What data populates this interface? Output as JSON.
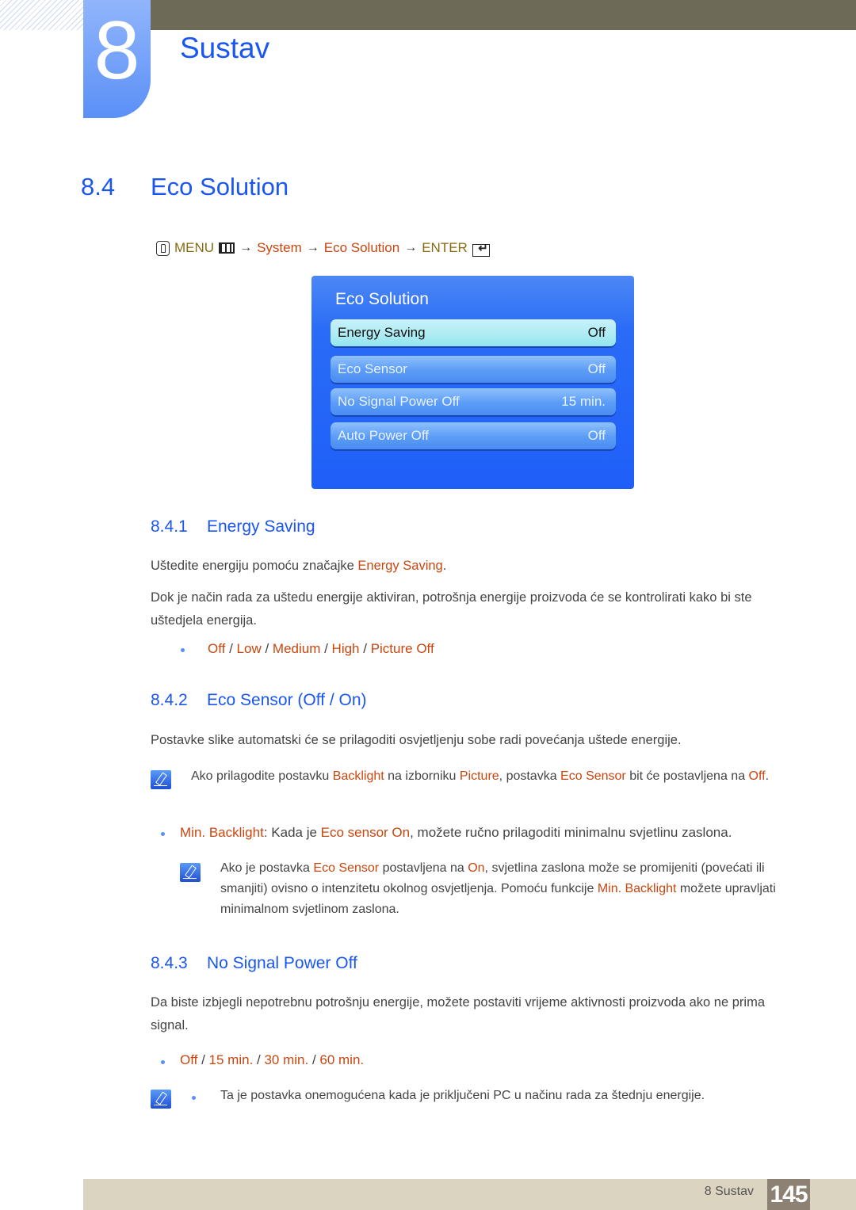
{
  "chapter": {
    "number": "8",
    "title": "Sustav"
  },
  "section": {
    "number": "8.4",
    "title": "Eco Solution"
  },
  "menu_path": {
    "menu": "MENU",
    "arrow": "→",
    "steps": [
      "System",
      "Eco Solution"
    ],
    "enter": "ENTER"
  },
  "osd": {
    "title": "Eco Solution",
    "rows": [
      {
        "label": "Energy Saving",
        "value": "Off",
        "selected": true
      },
      {
        "label": "Eco Sensor",
        "value": "Off",
        "selected": false
      },
      {
        "label": "No Signal Power Off",
        "value": "15 min.",
        "selected": false
      },
      {
        "label": "Auto Power Off",
        "value": "Off",
        "selected": false
      }
    ]
  },
  "sub1": {
    "number": "8.4.1",
    "title": "Energy Saving",
    "p1_pre": "Uštedite energiju pomoću značajke ",
    "p1_hl": "Energy Saving",
    "p1_post": ".",
    "p2": "Dok je način rada za uštedu energije aktiviran, potrošnja energije proizvoda će se kontrolirati kako bi ste uštedjela energija.",
    "options": [
      "Off",
      "Low",
      "Medium",
      "High",
      "Picture Off"
    ],
    "sep": " / "
  },
  "sub2": {
    "number": "8.4.2",
    "title": "Eco Sensor (Off / On)",
    "p1": "Postavke slike automatski će se prilagoditi osvjetljenju sobe radi povećanja uštede energije.",
    "note1": {
      "t1": "Ako prilagodite postavku ",
      "h1": "Backlight",
      "t2": " na izborniku ",
      "h2": "Picture",
      "t3": ", postavka ",
      "h3": "Eco Sensor",
      "t4": " bit će postavljena na ",
      "h4": "Off",
      "t5": "."
    },
    "bullet": {
      "h1": "Min. Backlight",
      "t1": ": Kada je ",
      "h2": "Eco sensor On",
      "t2": ", možete ručno prilagoditi minimalnu svjetlinu zaslona."
    },
    "note2": {
      "t1": "Ako je postavka ",
      "h1": "Eco Sensor",
      "t2": " postavljena na ",
      "h2": "On",
      "t3": ", svjetlina zaslona može se promijeniti (povećati ili smanjiti) ovisno o intenzitetu okolnog osvjetljenja. Pomoću funkcije ",
      "h3": "Min. Backlight",
      "t4": " možete upravljati minimalnom svjetlinom zaslona."
    }
  },
  "sub3": {
    "number": "8.4.3",
    "title": "No Signal Power Off",
    "p1": "Da biste izbjegli nepotrebnu potrošnju energije, možete postaviti vrijeme aktivnosti proizvoda ako ne prima signal.",
    "options": [
      "Off",
      "15 min.",
      "30 min.",
      "60 min."
    ],
    "sep": " / ",
    "note": "Ta je postavka onemogućena kada je priključeni PC u načinu rada za štednju energije."
  },
  "footer": {
    "label": "8 Sustav",
    "page": "145"
  }
}
